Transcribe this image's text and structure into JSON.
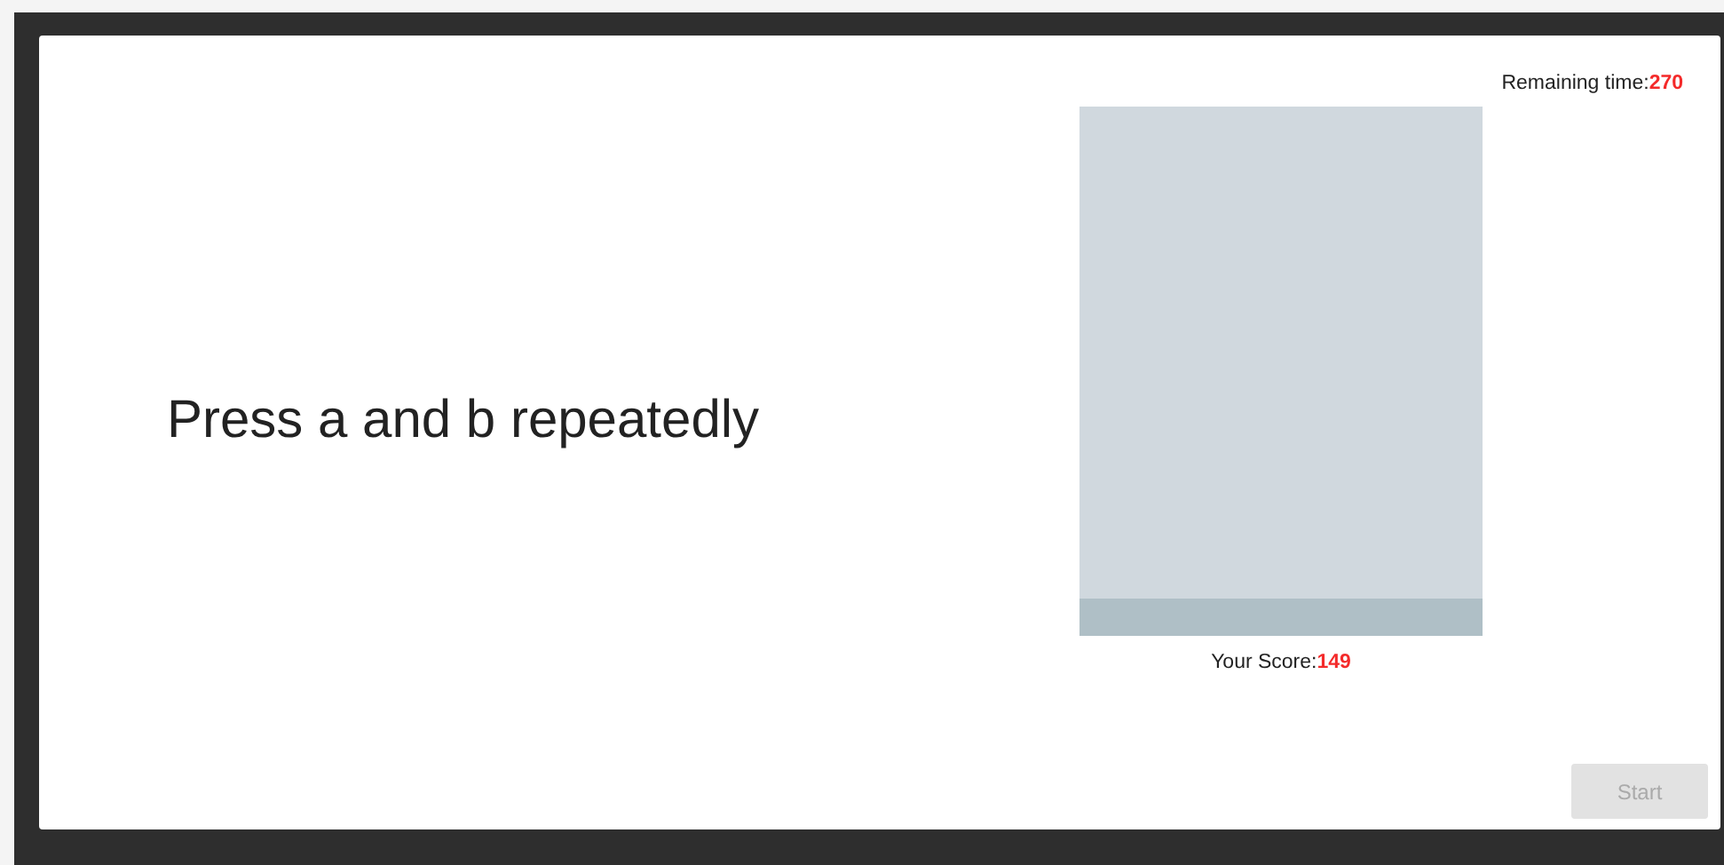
{
  "instruction": "Press a and b repeatedly",
  "remaining_time": {
    "label": "Remaining time:",
    "value": "270"
  },
  "meter": {
    "level": 0.07
  },
  "score": {
    "label": "Your Score:",
    "value": "149"
  },
  "start_button": {
    "label": "Start",
    "disabled": true
  }
}
